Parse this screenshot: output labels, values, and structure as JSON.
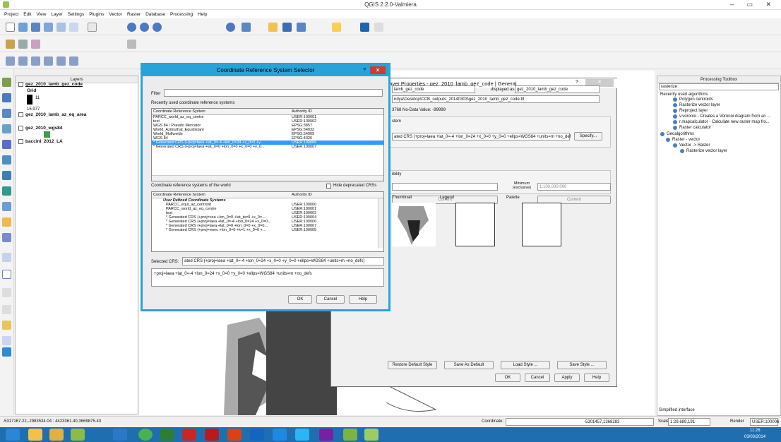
{
  "app": {
    "title": "QGIS 2.2.0-Valmiera",
    "win_controls": "– ▭ ✕"
  },
  "menu": [
    "Project",
    "Edit",
    "View",
    "Layer",
    "Settings",
    "Plugins",
    "Vector",
    "Raster",
    "Database",
    "Processing",
    "Help"
  ],
  "layers": {
    "title": "Layers",
    "items": [
      {
        "name": "gez_2010_lamb_gez_code",
        "checked": true
      },
      {
        "name": "Grid"
      },
      {
        "name": "11"
      },
      {
        "name": "15.977"
      },
      {
        "name": "gez_2010_lamb_az_eq_area"
      },
      {
        "name": "gez_2010_wgs84"
      },
      {
        "name": "baccini_2012_LA"
      }
    ]
  },
  "crs_dialog": {
    "title": "Coordinate Reference System Selector",
    "filter_label": "Filter",
    "recent_label": "Recently used coordinate reference systems",
    "col_crs": "Coordinate Reference System",
    "col_auth": "Authority ID",
    "recent": [
      [
        "PARCC_world_az_eq_centre",
        "USER:100001"
      ],
      [
        "test",
        "USER:100002"
      ],
      [
        "WGS 84 / Pseudo Mercator",
        "EPSG:3857"
      ],
      [
        "World_Azimuthal_Equidistant",
        "EPSG:54032"
      ],
      [
        "World_Mollweide",
        "EPSG:54009"
      ],
      [
        "WGS 84",
        "EPSG:4326"
      ],
      [
        "* Generated CRS (+proj=laea +lat_0=-4 +lon_0=24 +x_0=0 +y...",
        "USER:100006"
      ],
      [
        "* Generated CRS (+proj=laea +lat_0=0 +lon_0=0 +x_0=0 +y_0...",
        "USER:100007"
      ]
    ],
    "world_label": "Coordinate reference systems of the world",
    "hide_deprecated": "Hide deprecated CRSs",
    "user_defined": "User Defined Coordinate Systems",
    "world": [
      [
        "PARCC_equi_az_centroid",
        "USER:100000"
      ],
      [
        "PARCC_world_az_eq_centre",
        "USER:100001"
      ],
      [
        "test",
        "USER:100002"
      ],
      [
        "* Generated CRS (+proj=cea +lon_0=0 +lat_ts=0 +x_0=...",
        "USER:100004"
      ],
      [
        "* Generated CRS (+proj=laea +lat_0=-4 +lon_0=24 +x_0=0...",
        "USER:100006"
      ],
      [
        "* Generated CRS (+proj=laea +lat_0=0 +lon_0=0 +x_0=0...",
        "USER:100007"
      ],
      [
        "* Generated CRS (+proj=merc +lon_0=0 +k=1 +x_0=0 +...",
        "USER:100005"
      ]
    ],
    "selected_label": "Selected CRS:",
    "selected_value": "ated CRS (+proj=laea +lat_0=-4 +lon_0=24 +x_0=0 +y_0=0 +ellps=WGS84 +units=m +no_defs)",
    "proj_string": "+proj=laea +lat_0=-4 +lon_0=24 +x_0=0 +y_0=0 +ellps=WGS84 +units=m +no_defs",
    "ok": "OK",
    "cancel": "Cancel",
    "help": "Help"
  },
  "layer_props": {
    "title": "Layer Properties - gez_2010_lamb_gez_code | General",
    "name_val": "lamb_gez_code",
    "displayed_as": "displayed as",
    "displayed_val": "gez_2010_lamb_gez_code",
    "path": "ndya\\Desktop\\CCB_outputs_20140303\\gez_2010_lamb_gez_code.tif",
    "nodata": "3768  No-Data Value: -99999",
    "system": "stem",
    "crs_val": "ated CRS (+proj=laea +lat_0=-4 +lon_0=24 +x_0=0 +y_0=0 +ellps=WGS84 +units=m +no_def",
    "specify": "Specify...",
    "visibility": "ibility",
    "minimum": "Minimum (exclusive)",
    "scale_val": "1:100,000,000",
    "current1": "Current",
    "current2": "Current",
    "thumbnail": "Thumbnail",
    "legend": "Legend",
    "palette": "Palette",
    "restore": "Restore Default Style",
    "save_default": "Save As Default",
    "load_style": "Load Style ...",
    "save_style": "Save Style ...",
    "ok": "OK",
    "cancel": "Cancel",
    "apply": "Apply",
    "help": "Help"
  },
  "toolbox": {
    "title": "Processing Toolbox",
    "search": "rasterize",
    "items": [
      {
        "t": "Recently used algorithms",
        "lvl": 0
      },
      {
        "t": "Polygon centroids",
        "lvl": 2
      },
      {
        "t": "Rasterize vector layer",
        "lvl": 2
      },
      {
        "t": "Reproject layer",
        "lvl": 2
      },
      {
        "t": "v.voronoi - Creates a Voronoi diagram from an ...",
        "lvl": 2
      },
      {
        "t": "r.mapcalculator - Calculate new raster map fro...",
        "lvl": 2
      },
      {
        "t": "Raster calculator",
        "lvl": 2
      },
      {
        "t": "Geoalgorithms",
        "lvl": 0
      },
      {
        "t": "Raster - vector",
        "lvl": 1
      },
      {
        "t": "Vector -> Raster",
        "lvl": 2
      },
      {
        "t": "Rasterize vector layer",
        "lvl": 3
      }
    ],
    "simplified": "Simplified interface"
  },
  "status": {
    "coords": "-5317167.22,-2983534.04 : 4423361.40,3669875.43",
    "coordinate_label": "Coordinate:",
    "coordinate_val": "-5301457,1368283",
    "scale_label": "Scale",
    "scale_val": "1:29,689,191",
    "render": "Render",
    "crs": "USER:100006"
  },
  "clock": {
    "time": "11:26",
    "date": "03/03/2014"
  }
}
